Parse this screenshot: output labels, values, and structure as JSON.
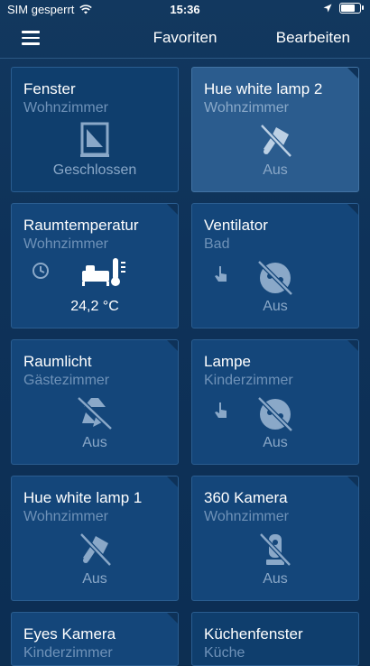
{
  "status_bar": {
    "carrier": "SIM gesperrt",
    "time": "15:36",
    "battery_level": 0.85
  },
  "nav": {
    "title": "Favoriten",
    "edit_label": "Bearbeiten"
  },
  "tiles": [
    {
      "name": "Fenster",
      "room": "Wohnzimmer",
      "state": "Geschlossen",
      "icon": "window-icon"
    },
    {
      "name": "Hue white lamp 2",
      "room": "Wohnzimmer",
      "state": "Aus",
      "icon": "lamp-off-icon"
    },
    {
      "name": "Raumtemperatur",
      "room": "Wohnzimmer",
      "state": "24,2 °C",
      "icon": "thermostat-icon"
    },
    {
      "name": "Ventilator",
      "room": "Bad",
      "state": "Aus",
      "icon": "plug-off-icon"
    },
    {
      "name": "Raumlicht",
      "room": "Gästezimmer",
      "state": "Aus",
      "icon": "ceiling-light-off-icon"
    },
    {
      "name": "Lampe",
      "room": "Kinderzimmer",
      "state": "Aus",
      "icon": "plug-off-icon"
    },
    {
      "name": "Hue white lamp 1",
      "room": "Wohnzimmer",
      "state": "Aus",
      "icon": "lamp-off-icon"
    },
    {
      "name": "360 Kamera",
      "room": "Wohnzimmer",
      "state": "Aus",
      "icon": "camera-off-icon"
    },
    {
      "name": "Eyes Kamera",
      "room": "Kinderzimmer",
      "state": "",
      "icon": "camera-icon"
    },
    {
      "name": "Küchenfenster",
      "room": "Küche",
      "state": "",
      "icon": "window-icon"
    }
  ]
}
